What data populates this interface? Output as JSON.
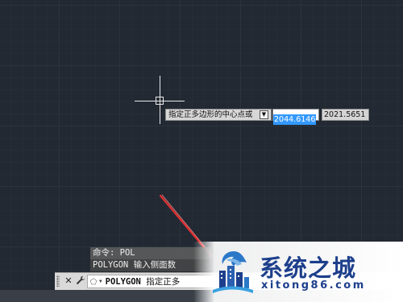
{
  "dynamic_input": {
    "prompt": "指定正多边形的中心点或",
    "down_arrow_icon": "arrow-down-icon",
    "x_value": "2044.6146",
    "y_value": "2021.5651"
  },
  "command_history": [
    "命令: POL",
    "POLYGON 输入侧面数"
  ],
  "command_bar": {
    "close_glyph": "✕",
    "customize_glyph": "🔧",
    "command_name": "POLYGON",
    "prompt_text": "指定正多"
  },
  "watermark": {
    "title": "系统之城",
    "url": "xitong86.com"
  },
  "colors": {
    "background": "#222933",
    "highlight": "#3399ff",
    "arrow": "#e03030",
    "brand": "#1d3f8c"
  }
}
